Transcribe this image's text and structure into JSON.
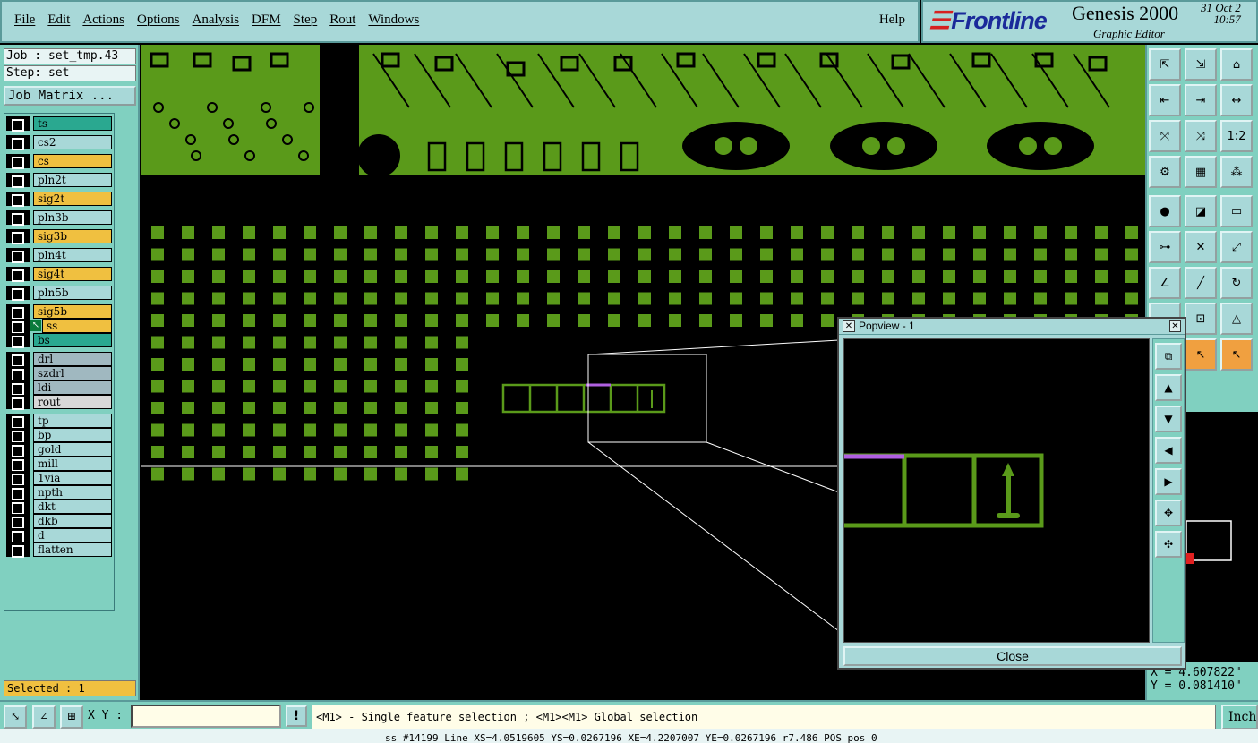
{
  "menubar": {
    "items": [
      "File",
      "Edit",
      "Actions",
      "Options",
      "Analysis",
      "DFM",
      "Step",
      "Rout",
      "Windows"
    ],
    "help": "Help"
  },
  "brand": {
    "logo": "Frontline",
    "product": "Genesis 2000",
    "subtitle": "Graphic Editor",
    "date_line1": "31 Oct 2",
    "date_line2": "10:57"
  },
  "job": {
    "job_label": "Job : set_tmp.43",
    "step_label": "Step: set",
    "matrix_button": "Job Matrix ..."
  },
  "layers": [
    {
      "name": "ts",
      "color": "#2aa890"
    },
    {
      "name": "cs2",
      "color": "#a8d8d8"
    },
    {
      "name": "cs",
      "color": "#f0c040"
    },
    {
      "name": "pln2t",
      "color": "#a8d8d8"
    },
    {
      "name": "sig2t",
      "color": "#f0c040"
    },
    {
      "name": "pln3b",
      "color": "#a8d8d8"
    },
    {
      "name": "sig3b",
      "color": "#f0c040"
    },
    {
      "name": "pln4t",
      "color": "#a8d8d8"
    },
    {
      "name": "sig4t",
      "color": "#f0c040"
    },
    {
      "name": "pln5b",
      "color": "#a8d8d8"
    },
    {
      "name": "sig5b",
      "color": "#f0c040"
    },
    {
      "name": "ss",
      "color": "#f0c040",
      "active": true
    },
    {
      "name": "bs",
      "color": "#2aa890"
    },
    {
      "name": "drl",
      "color": "#a0b8c0"
    },
    {
      "name": "szdrl",
      "color": "#a0b8c0"
    },
    {
      "name": "ldi",
      "color": "#a0b8c0"
    },
    {
      "name": "rout",
      "color": "#d8d8d8"
    },
    {
      "name": "tp",
      "color": "#a8d8d8"
    },
    {
      "name": "bp",
      "color": "#a8d8d8"
    },
    {
      "name": "gold",
      "color": "#a8d8d8"
    },
    {
      "name": "mill",
      "color": "#a8d8d8"
    },
    {
      "name": "1via",
      "color": "#a8d8d8"
    },
    {
      "name": "npth",
      "color": "#a8d8d8"
    },
    {
      "name": "dkt",
      "color": "#a8d8d8"
    },
    {
      "name": "dkb",
      "color": "#a8d8d8"
    },
    {
      "name": "d",
      "color": "#a8d8d8"
    },
    {
      "name": "flatten",
      "color": "#a8d8d8"
    }
  ],
  "selected": "Selected : 1",
  "popview": {
    "title": "Popview - 1",
    "close_label": "Close"
  },
  "coords": {
    "x": "X =  4.607822\"",
    "y": "Y =  0.081410\""
  },
  "bottom": {
    "xy_label": "X Y :",
    "xy_value": "",
    "bang": "!",
    "hint": "<M1> - Single feature selection ; <M1><M1> Global selection",
    "units": "Inch"
  },
  "status": "ss #14199 Line XS=4.0519605 YS=0.0267196 XE=4.2207007 YE=0.0267196 r7.486 POS pos 0",
  "colors": {
    "copper": "#5a9a1a",
    "highlight": "#b060e0",
    "panel": "#80d0c0"
  },
  "right_tools": [
    "tool-1-icon",
    "tool-2-icon",
    "tool-3-icon",
    "tool-4-icon",
    "tool-5-icon",
    "tool-6-icon",
    "tool-7-icon",
    "tool-8-icon",
    "tool-9-icon",
    "tool-10-icon",
    "tool-11-icon",
    "tool-12-icon"
  ]
}
